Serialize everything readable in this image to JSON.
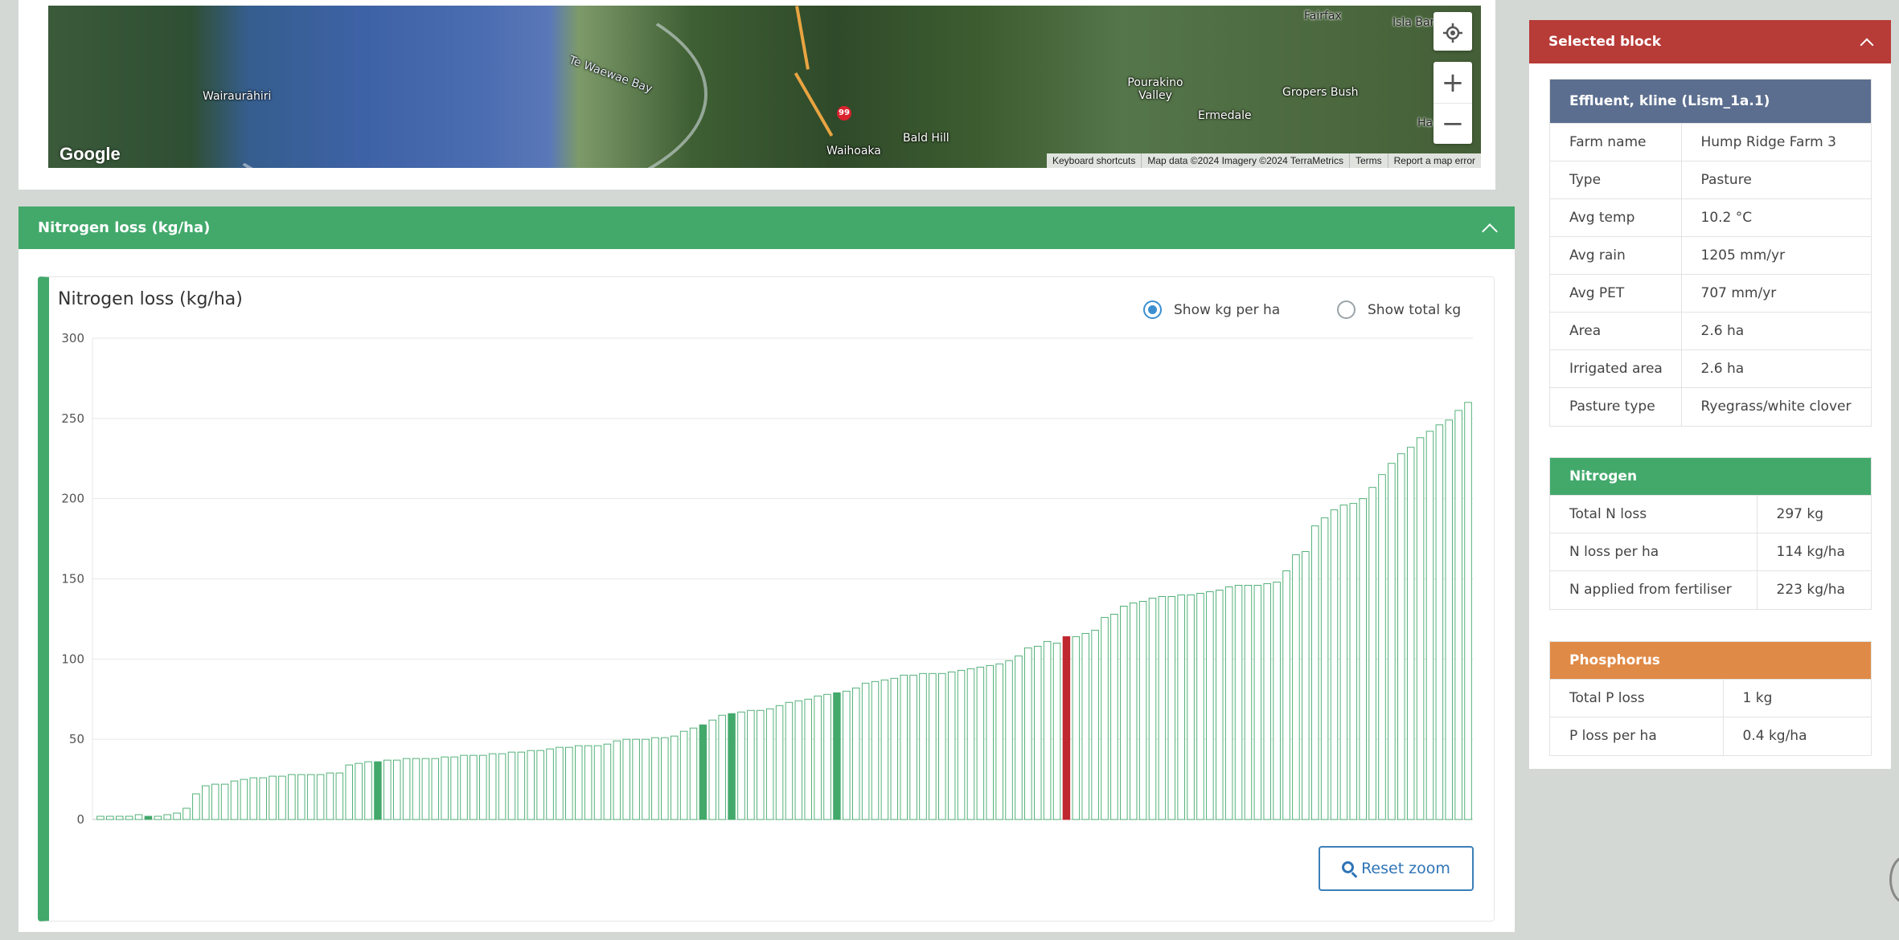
{
  "map": {
    "places": [
      "Wairaurāhiri",
      "Te Waewae Bay",
      "Waihoaka",
      "Bald Hill",
      "Pourakino Valley",
      "Ermedale",
      "Gropers Bush",
      "Fairfax",
      "Isla Bar",
      "Ha"
    ],
    "road_shield": "99",
    "logo": "Google",
    "attribution": [
      "Keyboard shortcuts",
      "Map data ©2024 Imagery ©2024 TerraMetrics",
      "Terms",
      "Report a map error"
    ],
    "controls": {
      "locate": "locate-icon",
      "zoom_in": "+",
      "zoom_out": "−"
    }
  },
  "nitrogen_section": {
    "header": "Nitrogen loss (kg/ha)",
    "chart_title": "Nitrogen loss (kg/ha)",
    "radio_options": [
      "Show kg per ha",
      "Show total kg"
    ],
    "selected_option": "Show kg per ha",
    "reset_zoom": "Reset zoom"
  },
  "chart_data": {
    "type": "bar",
    "title": "Nitrogen loss (kg/ha)",
    "xlabel": "",
    "ylabel": "",
    "ylim": [
      0,
      300
    ],
    "yticks": [
      0,
      50,
      100,
      150,
      200,
      250,
      300
    ],
    "grid": true,
    "colors": {
      "default": "#42a96b",
      "highlight": "#c0282f",
      "farm": "#42a96b"
    },
    "values": [
      2,
      2,
      2,
      2,
      3,
      2,
      2,
      3,
      4,
      7,
      16,
      21,
      22,
      22,
      24,
      25,
      26,
      26,
      27,
      27,
      28,
      28,
      28,
      28,
      29,
      29,
      34,
      35,
      36,
      36,
      37,
      37,
      38,
      38,
      38,
      38,
      39,
      39,
      40,
      40,
      40,
      41,
      41,
      42,
      42,
      43,
      43,
      44,
      45,
      45,
      46,
      46,
      46,
      47,
      49,
      50,
      50,
      50,
      51,
      51,
      52,
      55,
      57,
      59,
      62,
      65,
      66,
      67,
      68,
      68,
      69,
      71,
      73,
      74,
      75,
      77,
      78,
      79,
      80,
      82,
      85,
      86,
      87,
      88,
      90,
      90,
      91,
      91,
      91,
      92,
      93,
      94,
      95,
      96,
      97,
      99,
      102,
      107,
      108,
      111,
      110,
      114,
      114,
      116,
      118,
      126,
      128,
      133,
      135,
      136,
      138,
      139,
      139,
      140,
      140,
      141,
      142,
      143,
      145,
      146,
      146,
      146,
      147,
      148,
      155,
      165,
      167,
      183,
      188,
      193,
      196,
      197,
      200,
      207,
      215,
      222,
      228,
      232,
      238,
      242,
      246,
      249,
      255,
      260
    ],
    "highlight_index": 101,
    "farm_indices": [
      5,
      29,
      63,
      66,
      77
    ]
  },
  "selected_block": {
    "header": "Selected block",
    "block": {
      "title": "Effluent, kline (Lism_1a.1)",
      "color": "#5b6e8f",
      "rows": [
        [
          "Farm name",
          "Hump Ridge Farm 3"
        ],
        [
          "Type",
          "Pasture"
        ],
        [
          "Avg temp",
          "10.2 °C"
        ],
        [
          "Avg rain",
          "1205 mm/yr"
        ],
        [
          "Avg PET",
          "707 mm/yr"
        ],
        [
          "Area",
          "2.6 ha"
        ],
        [
          "Irrigated area",
          "2.6 ha"
        ],
        [
          "Pasture type",
          "Ryegrass/white clover"
        ]
      ]
    },
    "nitrogen": {
      "title": "Nitrogen",
      "color": "#42a96b",
      "rows": [
        [
          "Total N loss",
          "297 kg"
        ],
        [
          "N loss per ha",
          "114 kg/ha"
        ],
        [
          "N applied from fertiliser",
          "223 kg/ha"
        ]
      ]
    },
    "phosphorus": {
      "title": "Phosphorus",
      "color": "#e08a47",
      "rows": [
        [
          "Total P loss",
          "1 kg"
        ],
        [
          "P loss per ha",
          "0.4 kg/ha"
        ]
      ]
    }
  }
}
